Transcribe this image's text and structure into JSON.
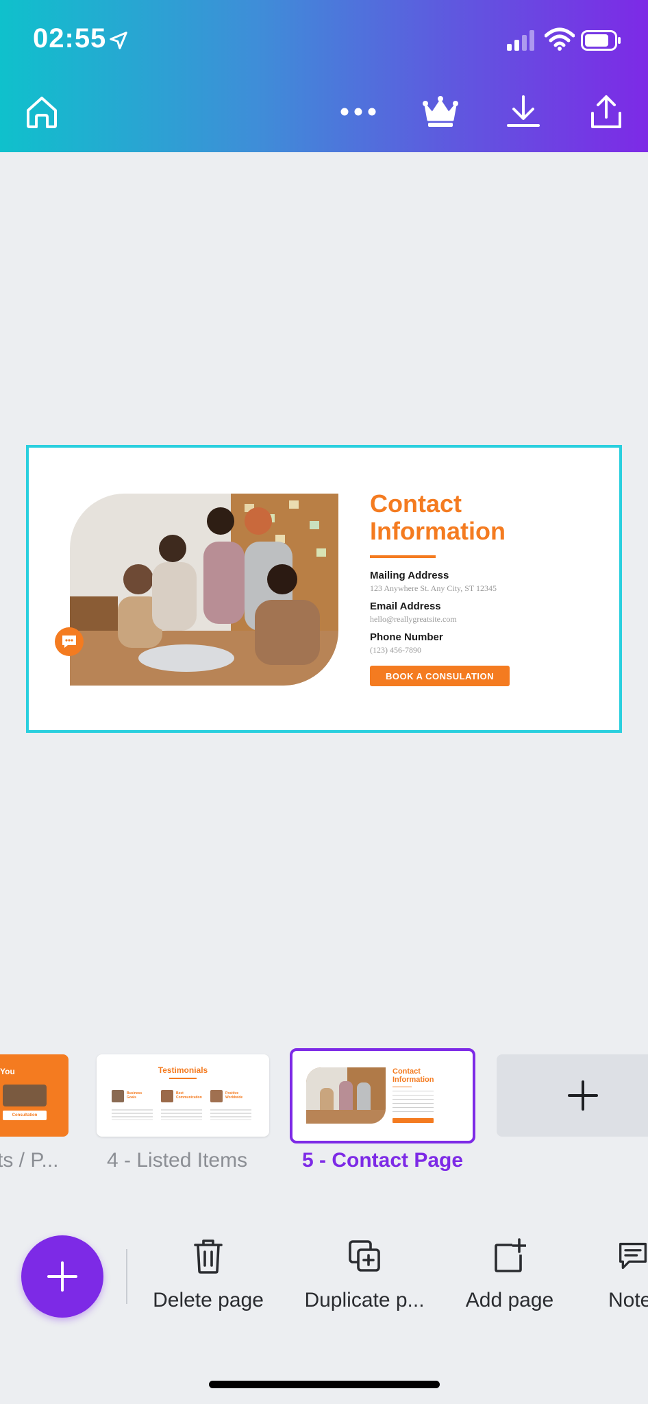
{
  "status_bar": {
    "time": "02:55"
  },
  "toolbar": {
    "home_icon": "home-icon",
    "more_icon": "more-dots-icon",
    "premium_icon": "crown-icon",
    "download_icon": "download-icon",
    "share_icon": "share-icon"
  },
  "slide": {
    "title_line1": "Contact",
    "title_line2": "Information",
    "fields": [
      {
        "label": "Mailing Address",
        "value": "123 Anywhere St. Any City, ST 12345"
      },
      {
        "label": "Email Address",
        "value": "hello@reallygreatsite.com"
      },
      {
        "label": "Phone Number",
        "value": "(123) 456-7890"
      }
    ],
    "cta": "BOOK A CONSULATION",
    "accent": "#F47B20",
    "selection_border": "#2ACFDE"
  },
  "pages": {
    "prev_thumb_text": "You",
    "prev_thumb_button": "Consultation",
    "prev_label": "ts / P...",
    "page4_title": "Testimonials",
    "page4_people": [
      "Business Goals",
      "Best Communication",
      "Positive Worldwide"
    ],
    "page4_label": "4 - Listed Items",
    "page5_title_line1": "Contact",
    "page5_title_line2": "Information",
    "page5_label": "5 - Contact Page",
    "active_color": "#7D2AE6"
  },
  "bottom_tools": {
    "delete": "Delete page",
    "duplicate": "Duplicate p...",
    "add": "Add page",
    "notes": "Note"
  }
}
